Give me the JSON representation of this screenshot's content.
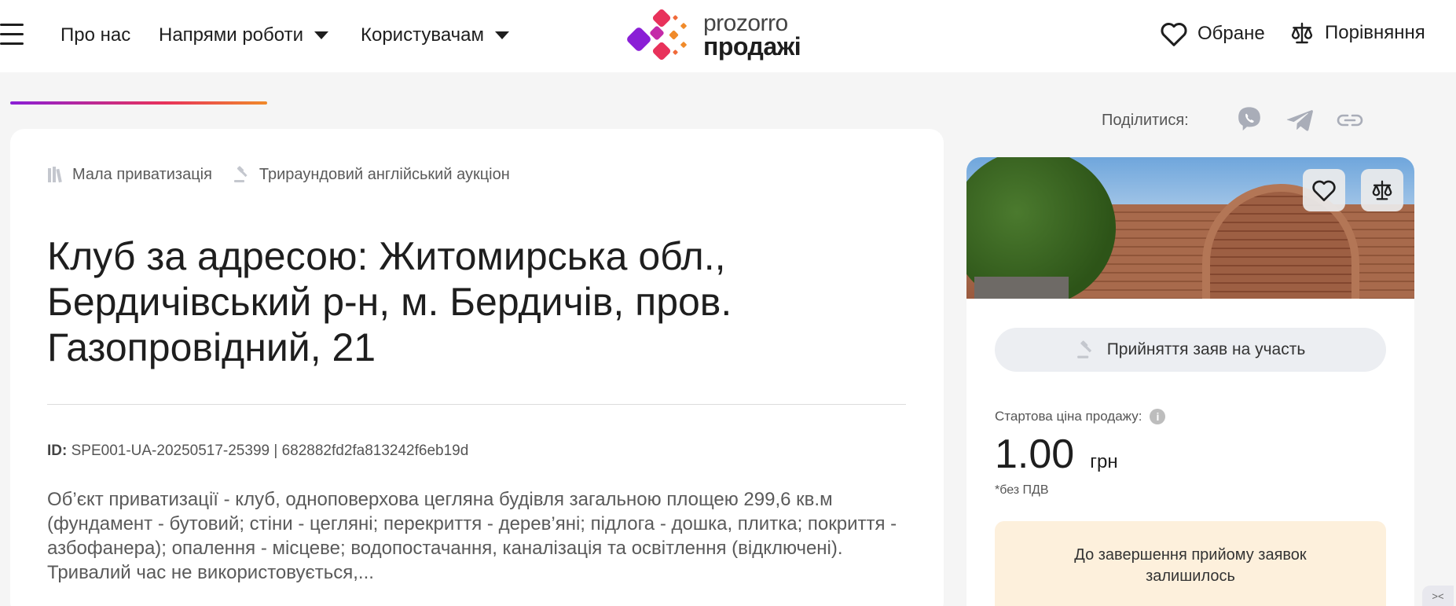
{
  "header": {
    "nav": [
      {
        "label": "Про нас"
      },
      {
        "label": "Напрями роботи"
      },
      {
        "label": "Користувачам"
      }
    ],
    "logo": {
      "top": "prozorro",
      "bottom": "продажі"
    },
    "favorites_label": "Обране",
    "compare_label": "Порівняння"
  },
  "share": {
    "label": "Поділитися:"
  },
  "lot": {
    "tags": [
      {
        "icon": "books-icon",
        "label": "Мала приватизація"
      },
      {
        "icon": "gavel-icon",
        "label": "Трираундовий англійський аукціон"
      }
    ],
    "title": "Клуб за адресою: Житомирська обл., Бердичівський р-н, м. Бердичів, пров. Газопровідний, 21",
    "id_label": "ID:",
    "id_value": "SPE001-UA-20250517-25399 | 682882fd2fa813242f6eb19d",
    "description": "Об’єкт приватизації - клуб, одноповерхова цегляна будівля загальною площею 299,6 кв.м (фундамент - бутовий; стіни - цегляні; перекриття - дерев’яні; підлога - дошка, плитка; покриття - азбофанера); опалення - місцеве; водопостачання, каналізація та освітлення (відключені). Тривалий час не використовується,..."
  },
  "sidebar": {
    "status": "Прийняття заяв на участь",
    "price_label": "Стартова ціна продажу:",
    "price_value": "1.00",
    "price_currency": "грн",
    "vat_note": "*без ПДВ",
    "timer_text": "До завершення прийому заявок залишилось"
  },
  "colors": {
    "accent_gradient": [
      "#8a1fd6",
      "#e8325b",
      "#f08a2a"
    ],
    "timer_bg": "#fdf0dc"
  }
}
